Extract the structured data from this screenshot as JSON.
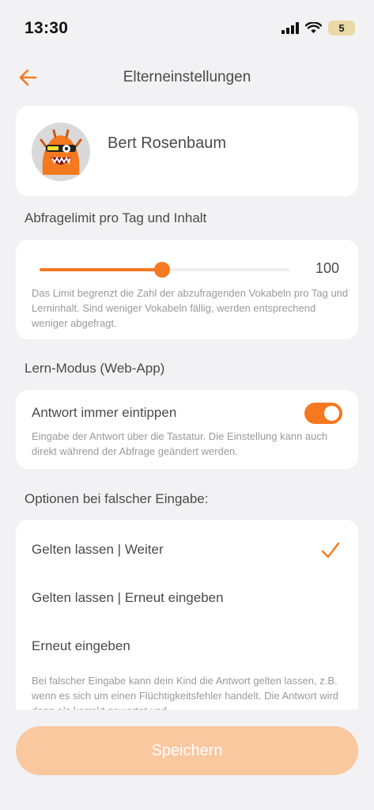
{
  "status_bar": {
    "time": "13:30",
    "battery": "5"
  },
  "nav": {
    "title": "Elterneinstellungen"
  },
  "profile": {
    "name": "Bert Rosenbaum"
  },
  "limit_section": {
    "heading": "Abfragelimit pro Tag und Inhalt",
    "slider_value": "100",
    "slider_fraction": 0.49,
    "help_text": "Das Limit begrenzt die Zahl der abzufragenden Vokabeln pro Tag und Lerninhalt. Sind weniger Vokabeln fällig, werden entsprechend weniger abgefragt."
  },
  "mode_section": {
    "heading": "Lern-Modus (Web-App)",
    "toggle_label": "Antwort immer eintippen",
    "toggle_on": true,
    "help_text": "Eingabe der Antwort über die Tastatur. Die Einstellung kann auch direkt während der Abfrage geändert werden."
  },
  "options_section": {
    "heading": "Optionen bei falscher Eingabe:",
    "options": [
      {
        "label": "Gelten lassen | Weiter",
        "selected": true
      },
      {
        "label": "Gelten lassen | Erneut eingeben",
        "selected": false
      },
      {
        "label": "Erneut eingeben",
        "selected": false
      }
    ],
    "help_text": "Bei falscher Eingabe kann dein Kind die Antwort gelten lassen, z.B. wenn es sich um einen Flüchtigkeitsfehler handelt. Die Antwort wird dann als korrekt gewertet und"
  },
  "save_button": {
    "label": "Speichern"
  },
  "colors": {
    "accent": "#f47920",
    "accent_light": "#f9c89f",
    "background": "#f2f2f4"
  },
  "icons": {
    "back": "arrow-left-icon",
    "check": "checkmark-icon",
    "signal": "cellular-signal-icon",
    "wifi": "wifi-icon"
  }
}
